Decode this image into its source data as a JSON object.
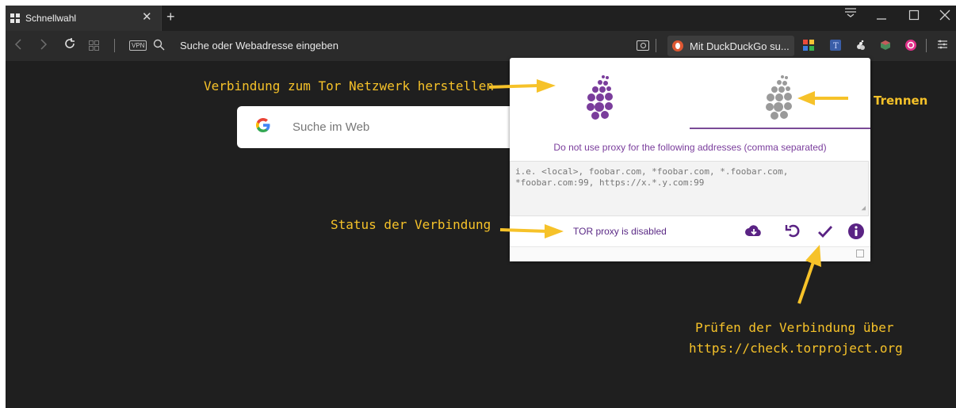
{
  "tab": {
    "title": "Schnellwahl"
  },
  "address_bar": {
    "vpn_label": "VPN",
    "placeholder": "Suche oder Webadresse eingeben"
  },
  "ddg_tab": {
    "title": "Mit DuckDuckGo su..."
  },
  "speed_dial": {
    "search_placeholder": "Suche im Web",
    "g_letter": "G"
  },
  "popup": {
    "no_proxy_label": "Do not use proxy for the following addresses (comma separated)",
    "exclusions_placeholder": "i.e. <local>, foobar.com, *foobar.com, *.foobar.com, *foobar.com:99, https://x.*.y.com:99",
    "status": "TOR proxy is disabled"
  },
  "annotations": {
    "connect": "Verbindung zum Tor Netzwerk herstellen",
    "disconnect": "Trennen",
    "status": "Status der Verbindung",
    "check_line1": "Prüfen der Verbindung über",
    "check_line2": "https://check.torproject.org"
  },
  "colors": {
    "accent": "#f6c229",
    "tor_purple": "#7a3d9c",
    "frame_bg": "#1f1f1f"
  }
}
